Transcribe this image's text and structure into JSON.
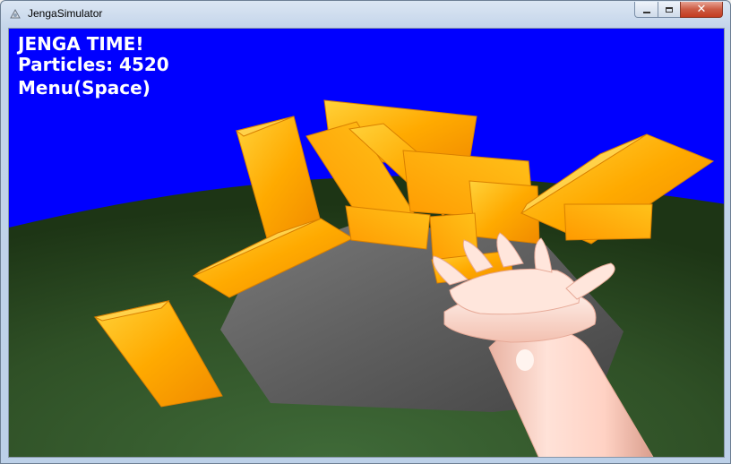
{
  "window": {
    "title": "JengaSimulator",
    "minimize_label": "Minimize",
    "maximize_label": "Maximize",
    "close_glyph": "✕"
  },
  "hud": {
    "title": "JENGA TIME!",
    "particles": "Particles: 4520",
    "menu_hint": "Menu(Space)"
  },
  "scene": {
    "sky_color": "#0000ff",
    "ground_color": "#2f4a22",
    "block_color": "#ffaa00",
    "table_color": "#5e5e5e",
    "hand_color": "#ffd2c4"
  }
}
